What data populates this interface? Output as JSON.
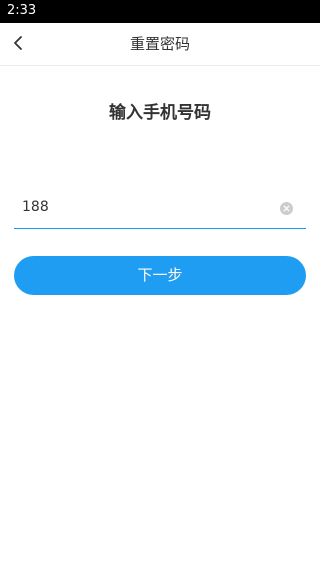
{
  "status_bar": {
    "time": "2:33"
  },
  "nav": {
    "back_icon": "chevron-left-icon",
    "title": "重置密码"
  },
  "form": {
    "heading": "输入手机号码",
    "phone_value": "188",
    "clear_icon": "clear-icon",
    "next_label": "下一步"
  },
  "colors": {
    "status_bar_bg": "#000000",
    "accent": "#1e9df2",
    "text": "#333333",
    "clear_icon": "#cccccc"
  }
}
